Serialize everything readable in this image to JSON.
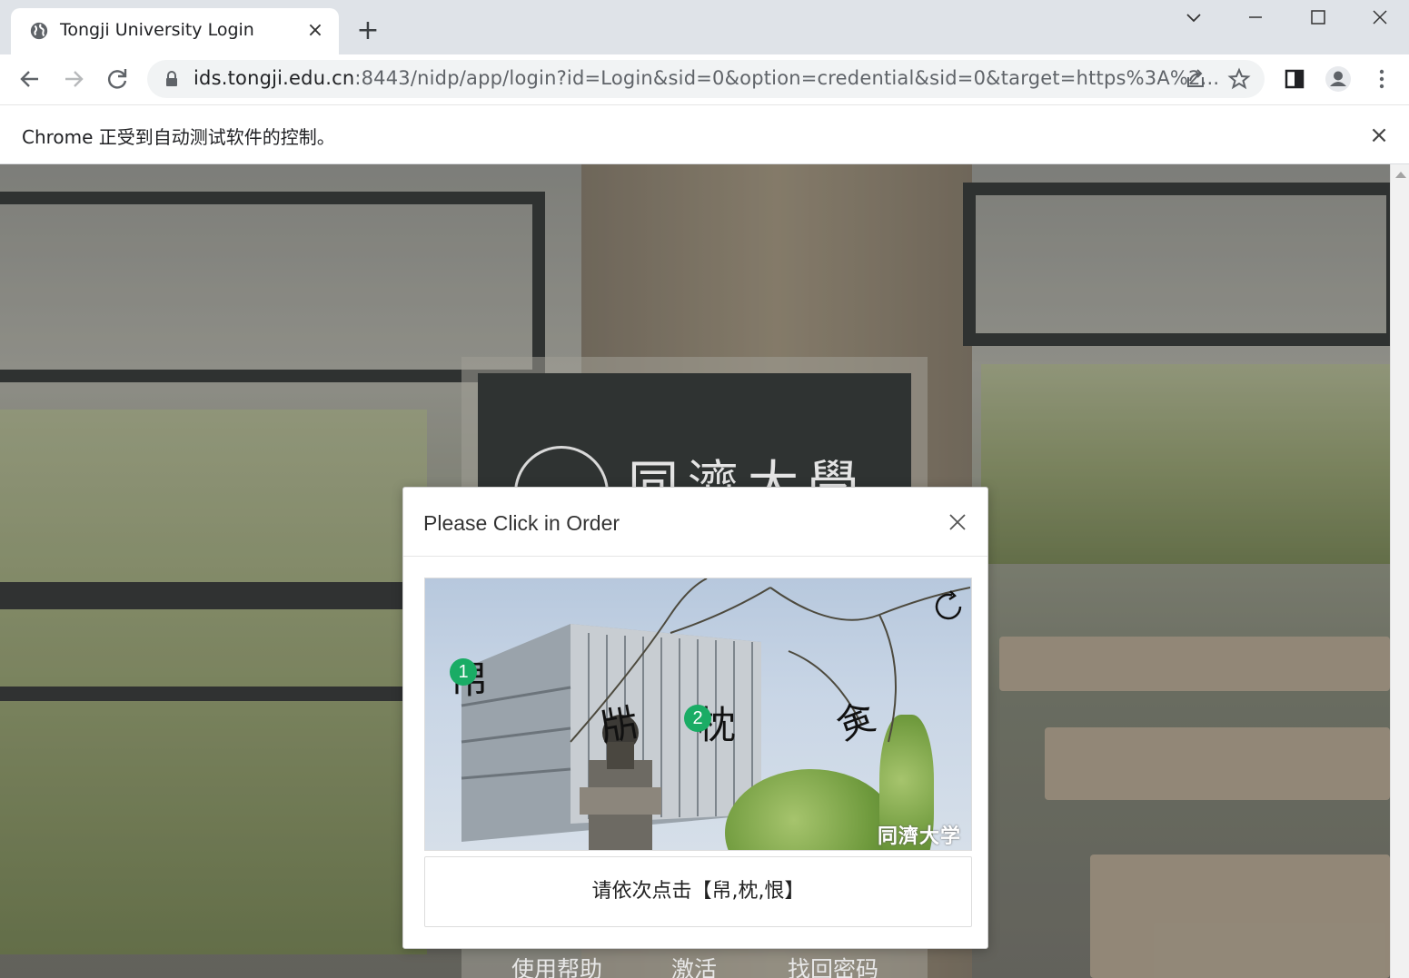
{
  "browser": {
    "tab_title": "Tongji University Login",
    "tab_close": "×",
    "new_tab": "+",
    "url_host": "ids.tongji.edu.cn",
    "url_rest": ":8443/nidp/app/login?id=Login&sid=0&option=credential&sid=0&target=https%3A%2..."
  },
  "infobar": {
    "text": "Chrome 正受到自动测试软件的控制。",
    "close": "×"
  },
  "login": {
    "logo_text": "同濟大學",
    "links": [
      "使用帮助",
      "激活",
      "找回密码"
    ]
  },
  "captcha": {
    "title": "Please Click in Order",
    "chars": [
      "帠",
      "㸞",
      "枕",
      "㑒"
    ],
    "markers": [
      "1",
      "2"
    ],
    "watermark": "同濟大学",
    "prompt": "请依次点击【帠,枕,恨】"
  },
  "colors": {
    "accent_green": "#1aac65",
    "chrome_bg": "#dfe3e8"
  }
}
